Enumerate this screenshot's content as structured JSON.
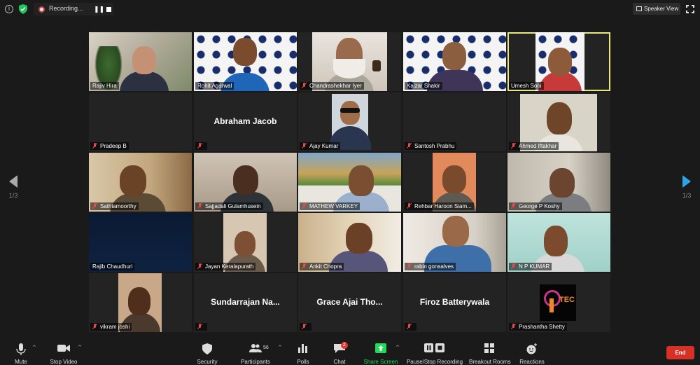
{
  "topbar": {
    "info_icon": "i",
    "recording_label": "Recording...",
    "speaker_view_label": "Speaker View"
  },
  "pager": {
    "left": "1/3",
    "right": "1/3"
  },
  "participants": [
    {
      "name": "Rajiv Hira",
      "muted": false
    },
    {
      "name": "Rohit Agarwal",
      "muted": false
    },
    {
      "name": "Chandrashekhar Iyer",
      "muted": true
    },
    {
      "name": "Kaizar Shakir",
      "muted": false
    },
    {
      "name": "Umesh Soni",
      "muted": false,
      "active_speaker": true
    },
    {
      "name": "Pradeep B",
      "muted": true
    },
    {
      "name": "",
      "display_name": "Abraham Jacob",
      "muted": true
    },
    {
      "name": "Ajay Kumar",
      "muted": true
    },
    {
      "name": "Santosh Prabhu",
      "muted": true
    },
    {
      "name": "Ahmed Iftakhar",
      "muted": true
    },
    {
      "name": "Sathiamoorthy",
      "muted": true
    },
    {
      "name": "Sajjadali Gulamhusein",
      "muted": true
    },
    {
      "name": "MATHEW VARKEY",
      "muted": true
    },
    {
      "name": "Rehbar Haroon Siam...",
      "muted": true
    },
    {
      "name": "George P Koshy",
      "muted": true
    },
    {
      "name": "Rajib Chaudhuri",
      "muted": false
    },
    {
      "name": "Jayan Keralapurath",
      "muted": true
    },
    {
      "name": "Ankit Chopra",
      "muted": true
    },
    {
      "name": "rabin gonsalves",
      "muted": true
    },
    {
      "name": "N P KUMAR",
      "muted": true
    },
    {
      "name": "vikram joshi",
      "muted": true
    },
    {
      "name": "",
      "display_name": "Sundarrajan Na...",
      "muted": true
    },
    {
      "name": "",
      "display_name": "Grace Ajai Tho...",
      "muted": true
    },
    {
      "name": "",
      "display_name": "Firoz Batterywala",
      "muted": true
    },
    {
      "name": "Prashantha Shetty",
      "muted": true
    }
  ],
  "toolbar": {
    "mute": "Mute",
    "stop_video": "Stop Video",
    "security": "Security",
    "participants": "Participants",
    "participants_count": "56",
    "polls": "Polls",
    "chat": "Chat",
    "chat_badge": "2",
    "share_screen": "Share Screen",
    "pause_stop_recording": "Pause/Stop Recording",
    "breakout_rooms": "Breakout Rooms",
    "reactions": "Reactions",
    "end": "End"
  },
  "colors": {
    "active_speaker_border": "#e6e87a",
    "share_green": "#23d959",
    "end_red": "#d93025",
    "muted_red": "#e84a4a"
  },
  "tile_logo_text": "TEC"
}
